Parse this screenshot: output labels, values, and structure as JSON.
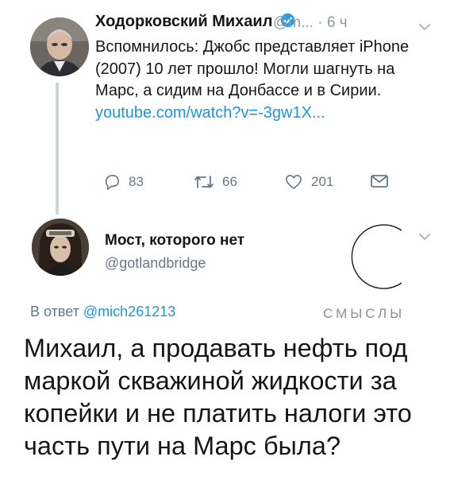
{
  "tweet_main": {
    "author_name": "Ходорковский Михаил",
    "handle": "@m...",
    "time": "· 6 ч",
    "text": "Вспомнилось: Джобс представляет iPhone (2007) 10 лет прошло! Могли шагнуть на Марс, а сидим на Донбассе и в Сирии.",
    "link": "youtube.com/watch?v=-3gw1X...",
    "replies": "83",
    "retweets": "66",
    "likes": "201",
    "verified_color": "#1da1f2",
    "link_color": "#1b95e0"
  },
  "tweet_reply": {
    "author_name": "Мост, которого нет",
    "handle": "@gotlandbridge",
    "reply_prefix": "В ответ",
    "reply_to": "@mich261213",
    "text": "Михаил, а продавать нефть под маркой скважиной жидкости за копейки и не платить налоги это часть пути на Марс была?"
  },
  "watermark": {
    "text": "СМЫСЛЫ"
  },
  "icons": [
    "verified-icon",
    "chevron-down-icon",
    "reply-icon",
    "retweet-icon",
    "like-icon",
    "message-icon"
  ]
}
